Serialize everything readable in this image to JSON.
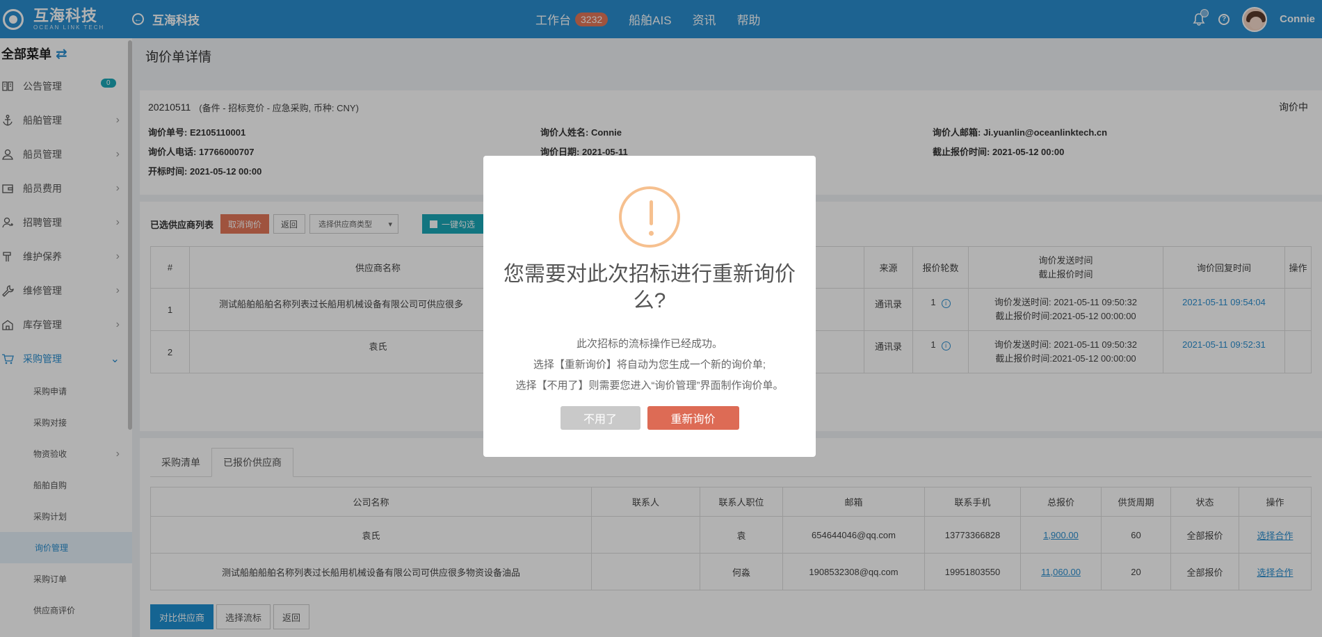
{
  "header": {
    "logo_cn": "互海科技",
    "logo_en": "OCEAN LINK TECH",
    "company": "互海科技",
    "nav": [
      {
        "label": "工作台",
        "badge": "3232"
      },
      {
        "label": "船舶AIS"
      },
      {
        "label": "资讯"
      },
      {
        "label": "帮助"
      }
    ],
    "username": "Connie"
  },
  "sidebar": {
    "title": "全部菜单",
    "items": [
      {
        "label": "公告管理",
        "icon": "announcement-icon",
        "badge": "0"
      },
      {
        "label": "船舶管理",
        "icon": "anchor-icon"
      },
      {
        "label": "船员管理",
        "icon": "crew-icon"
      },
      {
        "label": "船员费用",
        "icon": "wallet-icon"
      },
      {
        "label": "招聘管理",
        "icon": "recruit-icon"
      },
      {
        "label": "维护保养",
        "icon": "hammer-icon"
      },
      {
        "label": "维修管理",
        "icon": "wrench-icon"
      },
      {
        "label": "库存管理",
        "icon": "warehouse-icon"
      },
      {
        "label": "采购管理",
        "icon": "cart-icon"
      }
    ],
    "sub_items": [
      "采购申请",
      "采购对接",
      "物资验收",
      "船舶自购",
      "采购计划",
      "询价管理",
      "采购订单",
      "供应商评价"
    ]
  },
  "page": {
    "title": "询价单详情",
    "order_id": "20210511",
    "order_meta": "(备件 - 招标竞价 - 应急采购, 币种: CNY)",
    "status": "询价中",
    "info": [
      "询价单号: E2105110001",
      "询价人姓名: Connie",
      "询价人邮箱: Ji.yuanlin@oceanlinktech.cn",
      "询价人电话: 17766000707",
      "询价日期: 2021-05-11",
      "截止报价时间: 2021-05-12 00:00",
      "开标时间: 2021-05-12 00:00"
    ]
  },
  "suppliers": {
    "title": "已选供应商列表",
    "cancel_btn": "取消询价",
    "back_btn": "返回",
    "type_select": "选择供应商类型",
    "check_all": "一键勾选",
    "headers": [
      "#",
      "供应商名称",
      "来源",
      "报价轮数",
      "询价发送时间",
      "截止报价时间",
      "询价回复时间",
      "操作"
    ],
    "rows": [
      {
        "no": "1",
        "name": "测试船舶船舶名称列表过长船用机械设备有限公司可供应很多",
        "source": "通讯录",
        "rounds": "1",
        "sent": "询价发送时间: 2021-05-11 09:50:32",
        "deadline": "截止报价时间:2021-05-12 00:00:00",
        "reply": "2021-05-11 09:54:04"
      },
      {
        "no": "2",
        "name": "袁氏",
        "source": "通讯录",
        "rounds": "1",
        "sent": "询价发送时间: 2021-05-11 09:50:32",
        "deadline": "截止报价时间:2021-05-12 00:00:00",
        "reply": "2021-05-11 09:52:31"
      }
    ]
  },
  "quotes": {
    "tabs": [
      "采购清单",
      "已报价供应商"
    ],
    "headers": [
      "公司名称",
      "联系人",
      "联系人职位",
      "邮箱",
      "联系手机",
      "总报价",
      "供货周期",
      "状态",
      "操作"
    ],
    "rows": [
      {
        "company": "袁氏",
        "contact": "",
        "position": "袁",
        "email": "654644046@qq.com",
        "phone": "13773366828",
        "total": "1,900.00",
        "period": "60",
        "status": "全部报价",
        "action": "选择合作"
      },
      {
        "company": "测试船舶船舶名称列表过长船用机械设备有限公司可供应很多物资设备油品",
        "contact": "",
        "position": "何淼",
        "email": "1908532308@qq.com",
        "phone": "19951803550",
        "total": "11,060.00",
        "period": "20",
        "status": "全部报价",
        "action": "选择合作"
      }
    ],
    "compare_btn": "对比供应商",
    "fail_btn": "选择流标",
    "back_btn": "返回"
  },
  "modal": {
    "title": "您需要对此次招标进行重新询价么?",
    "lines": [
      "此次招标的流标操作已经成功。",
      "选择【重新询价】将自动为您生成一个新的询价单;",
      "选择【不用了】则需要您进入“询价管理”界面制作询价单。"
    ],
    "cancel_btn": "不用了",
    "confirm_btn": "重新询价",
    "colors": {
      "warn": "#f6c08f",
      "confirm": "#dd6b55",
      "cancel": "#c9c9c9"
    }
  }
}
